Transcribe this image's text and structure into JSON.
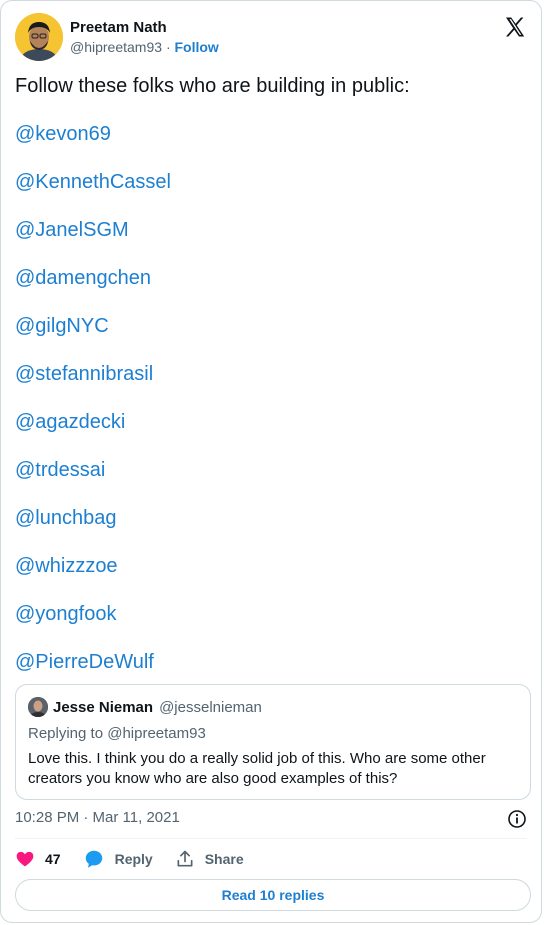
{
  "author": {
    "display_name": "Preetam Nath",
    "handle": "@hipreetam93",
    "separator": "·",
    "follow_label": "Follow"
  },
  "tweet": {
    "intro": "Follow these folks who are building in public:",
    "mentions": [
      "@kevon69",
      "@KennethCassel",
      "@JanelSGM",
      "@damengchen",
      "@gilgNYC",
      "@stefannibrasil",
      "@agazdecki",
      "@trdessai",
      "@lunchbag",
      "@whizzzoe",
      "@yongfook",
      "@PierreDeWulf"
    ]
  },
  "quoted": {
    "name": "Jesse Nieman",
    "handle": "@jesselnieman",
    "replying_to": "Replying to @hipreetam93",
    "text": "Love this. I think you do a really solid job of this. Who are some other creators you know who are also good examples of this?"
  },
  "meta": {
    "timestamp": "10:28 PM · Mar 11, 2021"
  },
  "actions": {
    "like_count": "47",
    "reply_label": "Reply",
    "share_label": "Share"
  },
  "read_replies": "Read 10 replies",
  "icons": {
    "logo": "x-logo-icon",
    "info": "info-icon",
    "like": "heart-icon",
    "reply": "speech-bubble-icon",
    "share": "share-upload-icon"
  },
  "colors": {
    "link": "#1d7fd1",
    "like": "#f91880",
    "secondary_text": "#536471",
    "border": "#cfd9de",
    "avatar_bg": "#f6c431"
  }
}
